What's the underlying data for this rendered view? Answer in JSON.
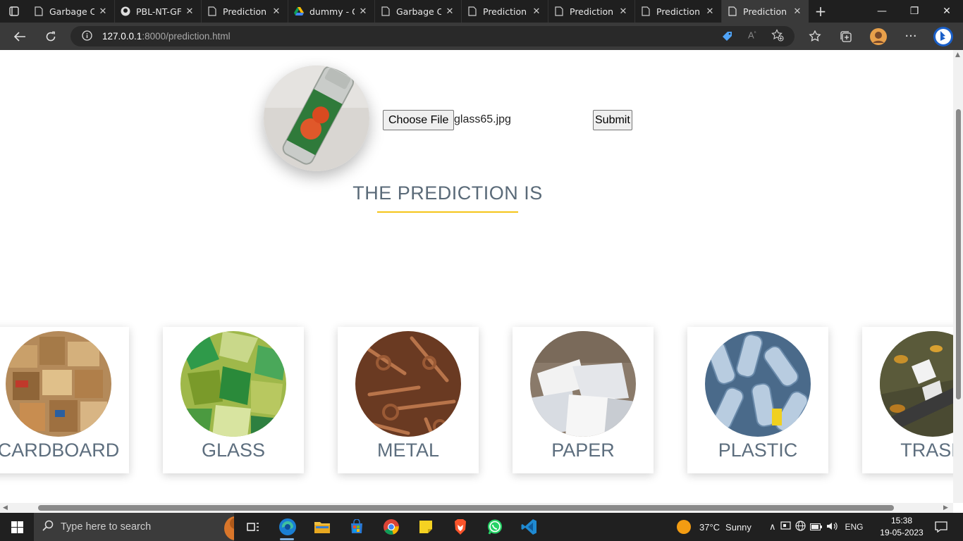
{
  "browser": {
    "tabs": [
      {
        "label": "Garbage C",
        "icon": "page-icon",
        "active": false
      },
      {
        "label": "PBL-NT-GF",
        "icon": "github-icon",
        "active": false
      },
      {
        "label": "Prediction",
        "icon": "page-icon",
        "active": false
      },
      {
        "label": "dummy - G",
        "icon": "google-drive-icon",
        "active": false
      },
      {
        "label": "Garbage C",
        "icon": "page-icon",
        "active": false
      },
      {
        "label": "Prediction",
        "icon": "page-icon",
        "active": false
      },
      {
        "label": "Prediction",
        "icon": "page-icon",
        "active": false
      },
      {
        "label": "Prediction",
        "icon": "page-icon",
        "active": false
      },
      {
        "label": "Prediction",
        "icon": "page-icon",
        "active": true
      }
    ],
    "url_host": "127.0.0.1",
    "url_path": ":8000/prediction.html"
  },
  "page": {
    "choose_file_label": "Choose File",
    "file_name": "glass65.jpg",
    "submit_label": "Submit",
    "prediction_heading": "THE PREDICTION IS",
    "accent_color": "#f5c518",
    "categories": [
      {
        "label": "CARDBOARD"
      },
      {
        "label": "GLASS"
      },
      {
        "label": "METAL"
      },
      {
        "label": "PAPER"
      },
      {
        "label": "PLASTIC"
      },
      {
        "label": "TRASH"
      }
    ]
  },
  "taskbar": {
    "search_placeholder": "Type here to search",
    "weather_temp": "37°C",
    "weather_desc": "Sunny",
    "language": "ENG",
    "time": "15:38",
    "date": "19-05-2023"
  }
}
